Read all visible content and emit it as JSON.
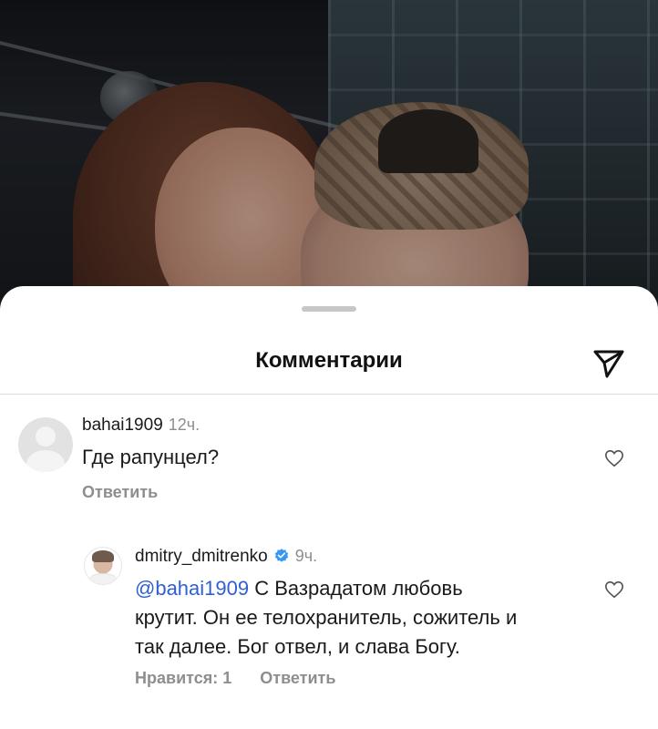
{
  "sheet": {
    "title": "Комментарии"
  },
  "comments": [
    {
      "username": "bahai1909",
      "time": "12ч.",
      "text": "Где  рапунцел?",
      "reply_label": "Ответить"
    },
    {
      "username": "dmitry_dmitrenko",
      "time": "9ч.",
      "mention": "@bahai1909",
      "text_line1": " С Вазрадатом любовь",
      "text_line2": "крутит. Он ее телохранитель, сожитель и",
      "text_line3": "так далее. Бог отвел, и слава Богу.",
      "likes_label": "Нравится: 1",
      "reply_label": "Ответить"
    }
  ],
  "colors": {
    "mention": "#2f5fd0",
    "verified": "#3897f0",
    "secondary_text": "#8e8e8e"
  },
  "icons": {
    "send": "paper-plane-icon",
    "like": "heart-outline-icon",
    "verified": "verified-badge-icon"
  }
}
